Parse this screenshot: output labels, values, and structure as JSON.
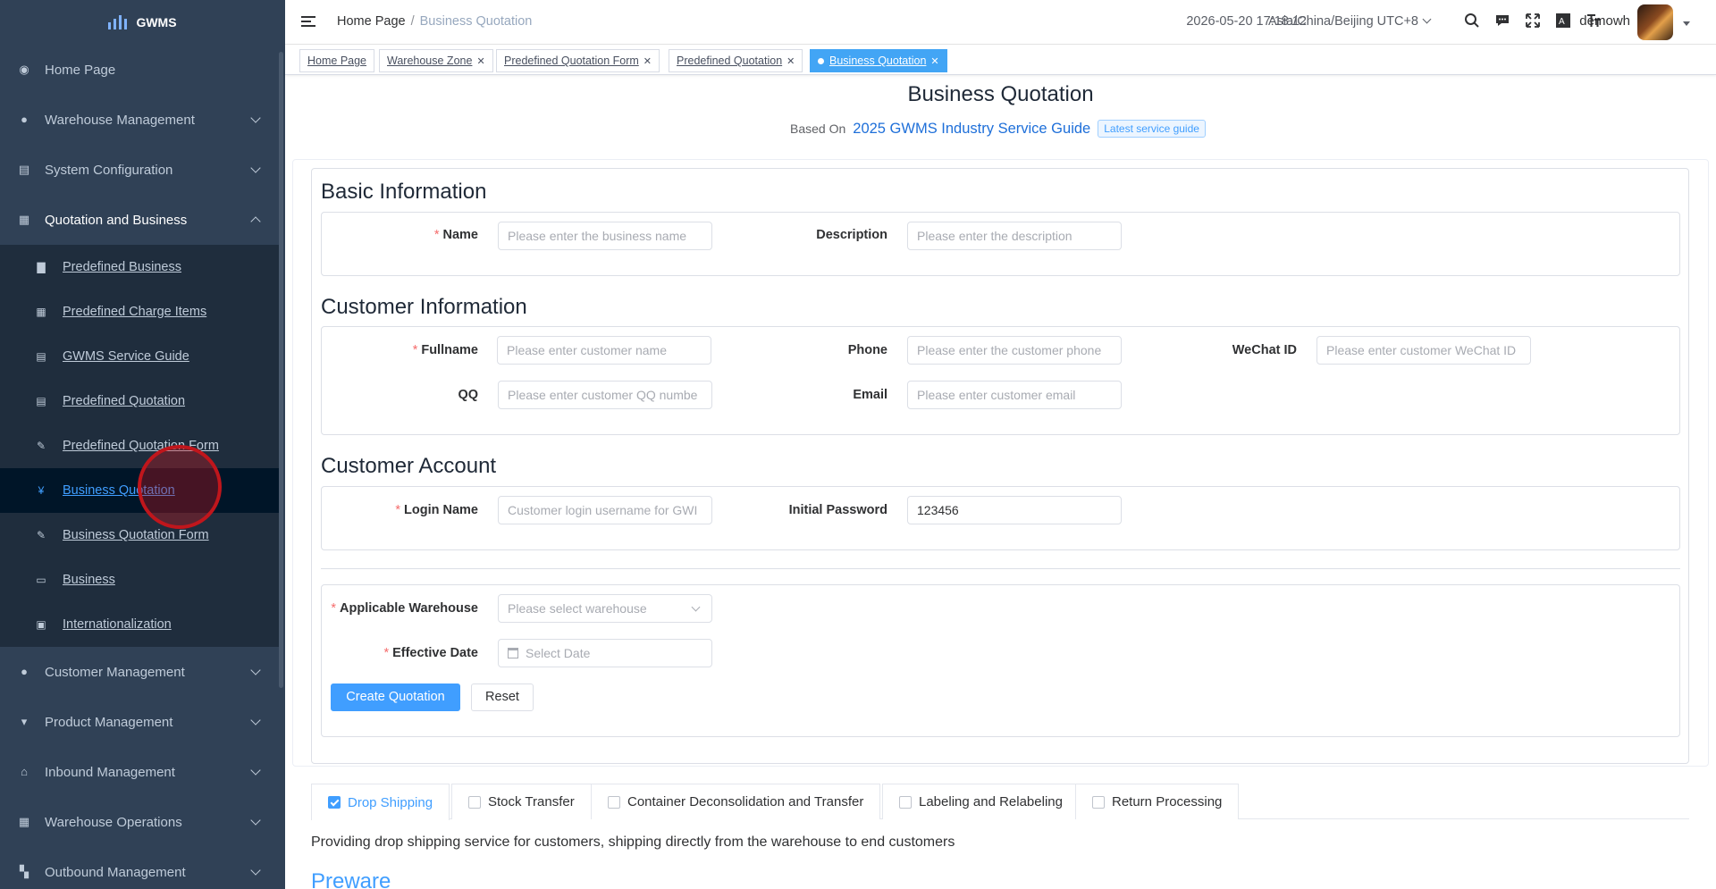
{
  "app": {
    "name": "GWMS"
  },
  "sidebar": {
    "menus": [
      {
        "label": "Home Page",
        "icon": "dashboard-icon"
      },
      {
        "label": "Warehouse Management",
        "icon": "globe-icon"
      },
      {
        "label": "System Configuration",
        "icon": "settings-icon"
      },
      {
        "label": "Quotation and Business",
        "icon": "quotation-icon"
      },
      {
        "label": "Customer Management",
        "icon": "user-icon"
      },
      {
        "label": "Product Management",
        "icon": "cart-icon"
      },
      {
        "label": "Inbound Management",
        "icon": "home-icon"
      },
      {
        "label": "Warehouse Operations",
        "icon": "grid-icon"
      },
      {
        "label": "Outbound Management",
        "icon": "apps-icon"
      }
    ],
    "sub_items": [
      {
        "label": "Predefined Business",
        "icon": "calendar-icon"
      },
      {
        "label": "Predefined Charge Items",
        "icon": "table-icon"
      },
      {
        "label": "GWMS Service Guide",
        "icon": "document-icon"
      },
      {
        "label": "Predefined Quotation",
        "icon": "document-icon"
      },
      {
        "label": "Predefined Quotation Form",
        "icon": "edit-icon"
      },
      {
        "label": "Business Quotation",
        "icon": "yen-icon"
      },
      {
        "label": "Business Quotation Form",
        "icon": "edit-icon"
      },
      {
        "label": "Business",
        "icon": "briefcase-icon"
      },
      {
        "label": "Internationalization",
        "icon": "language-icon"
      }
    ]
  },
  "navbar": {
    "breadcrumb": [
      "Home Page",
      "Business Quotation"
    ],
    "datetime": "2026-05-20 17:18:12",
    "timezone": "Asia/China/Beijing UTC+8",
    "username": "demowh"
  },
  "tags": [
    {
      "label": "Home Page",
      "closable": false
    },
    {
      "label": "Warehouse Zone",
      "closable": true
    },
    {
      "label": "Predefined Quotation Form",
      "closable": true
    },
    {
      "label": "Predefined Quotation",
      "closable": true
    },
    {
      "label": "Business Quotation",
      "closable": true,
      "active": true
    }
  ],
  "page": {
    "title": "Business Quotation",
    "based_on_label": "Based On",
    "guide_link": "2025 GWMS Industry Service Guide",
    "guide_badge": "Latest service guide"
  },
  "form": {
    "basic": {
      "title": "Basic Information",
      "name_label": "Name",
      "name_placeholder": "Please enter the business name",
      "desc_label": "Description",
      "desc_placeholder": "Please enter the description"
    },
    "customer": {
      "title": "Customer Information",
      "fullname_label": "Fullname",
      "fullname_placeholder": "Please enter customer name",
      "phone_label": "Phone",
      "phone_placeholder": "Please enter the customer phone",
      "wechat_label": "WeChat ID",
      "wechat_placeholder": "Please enter customer WeChat ID",
      "qq_label": "QQ",
      "qq_placeholder": "Please enter customer QQ numbe",
      "email_label": "Email",
      "email_placeholder": "Please enter customer email"
    },
    "account": {
      "title": "Customer Account",
      "login_label": "Login Name",
      "login_placeholder": "Customer login username for GWI",
      "password_label": "Initial Password",
      "password_value": "123456"
    },
    "settings": {
      "warehouse_label": "Applicable Warehouse",
      "warehouse_placeholder": "Please select warehouse",
      "date_label": "Effective Date",
      "date_placeholder": "Select Date"
    },
    "create_button": "Create Quotation",
    "reset_button": "Reset"
  },
  "services": {
    "tabs": [
      {
        "label": "Drop Shipping",
        "checked": true
      },
      {
        "label": "Stock Transfer",
        "checked": false
      },
      {
        "label": "Container Deconsolidation and Transfer",
        "checked": false
      },
      {
        "label": "Labeling and Relabeling",
        "checked": false
      },
      {
        "label": "Return Processing",
        "checked": false
      }
    ],
    "description": "Providing drop shipping service for customers, shipping directly from the warehouse to end customers",
    "section_heading": "Preware"
  },
  "colors": {
    "sidebar_bg": "#304156",
    "submenu_bg": "#1f2d3d",
    "accent": "#409eff",
    "required": "#f56c6c"
  }
}
